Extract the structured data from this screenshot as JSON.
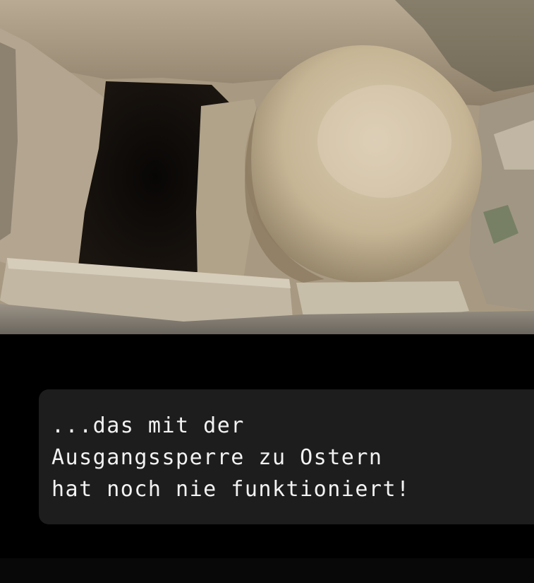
{
  "image": {
    "subject": "empty-tomb-with-rolled-stone",
    "colors": {
      "background": "#000000",
      "caption_box": "#1d1d1d",
      "caption_text": "#f2f2f2"
    }
  },
  "caption": {
    "lines": [
      "...das mit der",
      "Ausgangssperre zu Ostern",
      "hat noch nie funktioniert!"
    ]
  }
}
